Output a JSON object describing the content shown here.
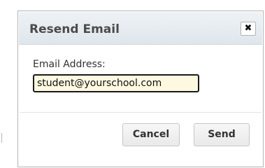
{
  "dialog": {
    "title": "Resend Email",
    "close_icon": "close-icon",
    "close_glyph": "✖"
  },
  "form": {
    "email_label": "Email Address:",
    "email_value": "student@yourschool.com"
  },
  "actions": {
    "cancel_label": "Cancel",
    "send_label": "Send"
  },
  "colors": {
    "header_background": "#e6ecf1",
    "input_background": "#fdf9e1",
    "button_background": "#f0f0f0"
  }
}
